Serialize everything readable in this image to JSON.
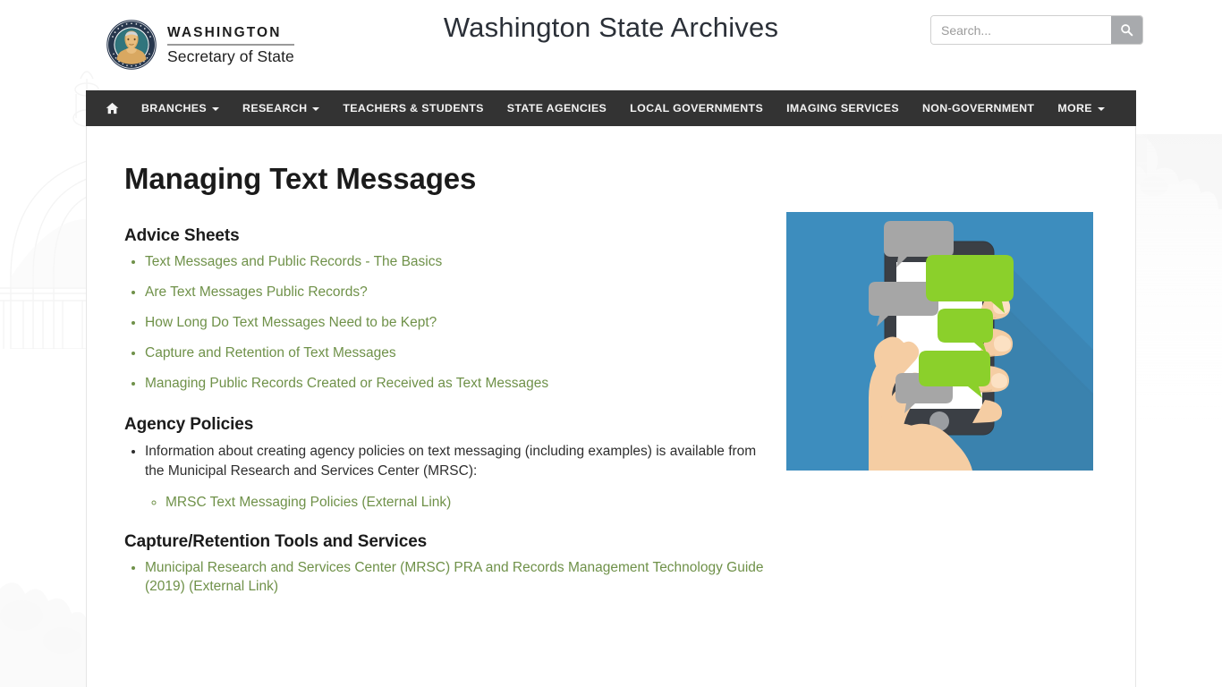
{
  "header": {
    "brand": {
      "seal_icon": "washington-state-seal-icon",
      "line1": "WASHINGTON",
      "line2": "Secretary of State"
    },
    "site_title": "Washington State Archives",
    "search": {
      "value": "",
      "placeholder": "Search...",
      "button_icon": "search-icon"
    }
  },
  "nav": {
    "home_icon": "home-icon",
    "items": [
      {
        "label": "BRANCHES",
        "has_caret": true
      },
      {
        "label": "RESEARCH",
        "has_caret": true
      },
      {
        "label": "TEACHERS & STUDENTS",
        "has_caret": false
      },
      {
        "label": "STATE AGENCIES",
        "has_caret": false
      },
      {
        "label": "LOCAL GOVERNMENTS",
        "has_caret": false
      },
      {
        "label": "IMAGING SERVICES",
        "has_caret": false
      },
      {
        "label": "NON-GOVERNMENT",
        "has_caret": false
      },
      {
        "label": "MORE",
        "has_caret": true
      }
    ]
  },
  "main": {
    "page_title": "Managing Text Messages",
    "sections": [
      {
        "heading": "Advice Sheets",
        "links": [
          "Text Messages and Public Records - The Basics",
          "Are Text Messages Public Records?",
          "How Long Do Text Messages Need to be Kept?",
          "Capture and Retention of Text Messages",
          "Managing Public Records Created or Received as Text Messages"
        ]
      },
      {
        "heading": "Agency Policies",
        "body": "Information about creating agency policies on text messaging (including examples) is available from the Municipal Research and Services Center (MRSC):",
        "sub_links": [
          "MRSC Text Messaging Policies (External Link)"
        ]
      },
      {
        "heading": "Capture/Retention Tools and Services",
        "links": [
          "Municipal Research and Services Center (MRSC) PRA and Records Management Technology Guide (2019) (External Link)"
        ]
      }
    ],
    "illustration": {
      "name": "text-messaging-phone-illustration",
      "background_color": "#3d8dbe",
      "bubble_green": "#8bd02b",
      "bubble_gray": "#a6a6a6",
      "phone_color": "#3b3f45",
      "skin_color": "#f5cda3"
    }
  },
  "colors": {
    "nav_background": "#333333",
    "link_green": "#6f9149",
    "title_text": "#1b1b1b",
    "search_button": "#a8aaad"
  }
}
